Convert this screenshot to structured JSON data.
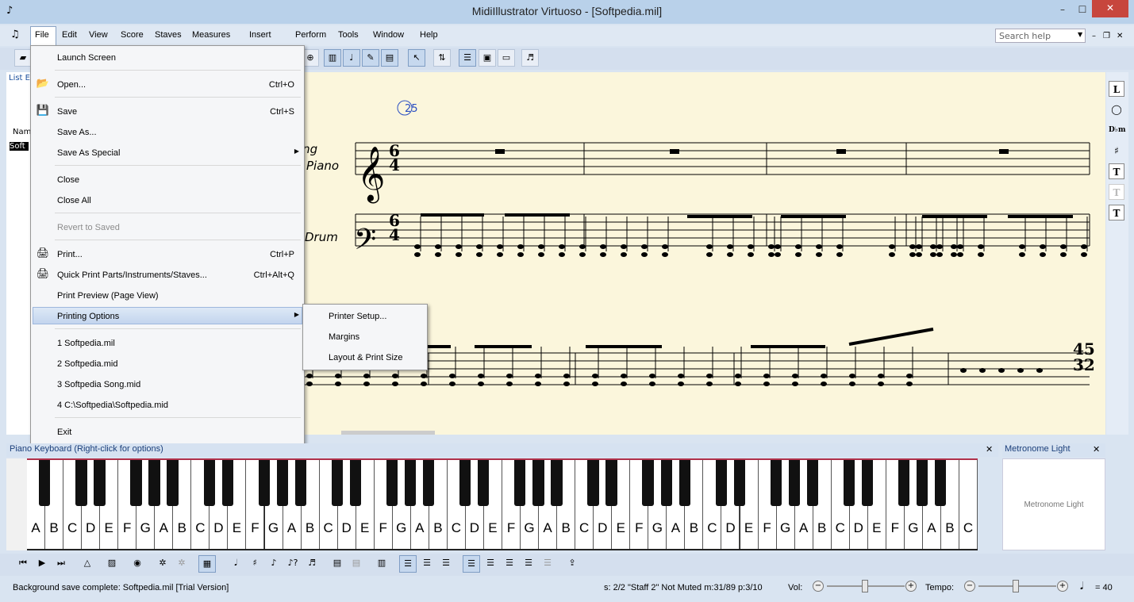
{
  "window": {
    "title": "MidiIllustrator Virtuoso - [Softpedia.mil]",
    "minimize": "–",
    "maximize": "☐",
    "close": "✕"
  },
  "menubar": {
    "items": [
      "File",
      "Edit",
      "View",
      "Score",
      "Staves",
      "Measures",
      "Insert",
      "Perform",
      "Tools",
      "Window",
      "Help"
    ],
    "search_placeholder": "Search help"
  },
  "left_panel": {
    "title": "List E",
    "name_col": "Nam",
    "row": "Soft"
  },
  "file_menu": {
    "items": [
      {
        "label": "Launch Screen",
        "shortcut": ""
      },
      {
        "label": "Open...",
        "shortcut": "Ctrl+O"
      },
      {
        "label": "Save",
        "shortcut": "Ctrl+S"
      },
      {
        "label": "Save As...",
        "shortcut": ""
      },
      {
        "label": "Save As Special",
        "shortcut": ""
      },
      {
        "label": "Close",
        "shortcut": ""
      },
      {
        "label": "Close All",
        "shortcut": ""
      },
      {
        "label": "Revert to Saved",
        "shortcut": ""
      },
      {
        "label": "Print...",
        "shortcut": "Ctrl+P"
      },
      {
        "label": "Quick Print Parts/Instruments/Staves...",
        "shortcut": "Ctrl+Alt+Q"
      },
      {
        "label": "Print Preview (Page View)",
        "shortcut": ""
      },
      {
        "label": "Printing Options",
        "shortcut": ""
      },
      {
        "label": "1 Softpedia.mil",
        "shortcut": ""
      },
      {
        "label": "2 Softpedia.mid",
        "shortcut": ""
      },
      {
        "label": "3 Softpedia Song.mid",
        "shortcut": ""
      },
      {
        "label": "4 C:\\Softpedia\\Softpedia.mid",
        "shortcut": ""
      },
      {
        "label": "Exit",
        "shortcut": ""
      }
    ]
  },
  "printing_submenu": {
    "items": [
      "Printer Setup...",
      "Margins",
      "Layout & Print Size"
    ]
  },
  "score": {
    "measure_number": "25",
    "staff1_label_a": "ong",
    "staff1_label_b": "Piano",
    "staff2_label": "Drum",
    "time_sig_num": "6",
    "time_sig_den": "4",
    "end_time_num": "45",
    "end_time_den": "32"
  },
  "right_toolbar": {
    "buttons": [
      "L",
      "◯",
      "D♭m",
      "♯",
      "T",
      "T",
      "T"
    ]
  },
  "piano": {
    "header": "Piano Keyboard (Right-click for options)",
    "close": "✕",
    "white_keys": [
      "A",
      "B",
      "C",
      "D",
      "E",
      "F",
      "G",
      "A",
      "B",
      "C",
      "D",
      "E",
      "F",
      "G",
      "A",
      "B",
      "C",
      "D",
      "E",
      "F",
      "G",
      "A",
      "B",
      "C",
      "D",
      "E",
      "F",
      "G",
      "A",
      "B",
      "C",
      "D",
      "E",
      "F",
      "G",
      "A",
      "B",
      "C",
      "D",
      "E",
      "F",
      "G",
      "A",
      "B",
      "C",
      "D",
      "E",
      "F",
      "G",
      "A",
      "B",
      "C"
    ]
  },
  "metronome": {
    "header": "Metronome Light",
    "close": "✕",
    "body": "Metronome Light"
  },
  "status": {
    "message": "Background save complete: Softpedia.mil  [Trial Version]",
    "staff_info": "s: 2/2 \"Staff 2\" Not Muted  m:31/89  p:3/10",
    "vol_label": "Vol:",
    "tempo_label": "Tempo:",
    "tempo_value": "= 40",
    "minus": "−",
    "plus": "+"
  },
  "colors": {
    "accent": "#c7463d",
    "score_bg": "#fbf6dc",
    "menu_highlight": "#c3d5ee"
  }
}
